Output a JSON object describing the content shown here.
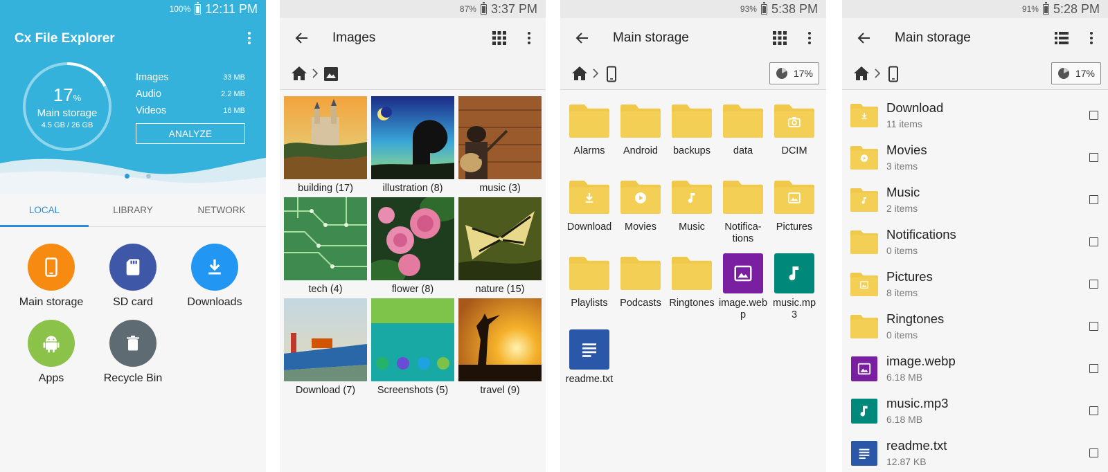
{
  "colors": {
    "accent": "#34b2dc",
    "tab_active": "#2d8ad8",
    "folder": "#f0c94c",
    "folder_glyph": "#ffffff",
    "image_tile": "#7b1fa2",
    "audio_tile": "#00897b",
    "text_tile": "#2b57a8"
  },
  "panel1": {
    "status": {
      "battery": "100%",
      "time": "12:11 PM"
    },
    "app_title": "Cx File Explorer",
    "storage": {
      "percent": "17",
      "percent_unit": "%",
      "label": "Main storage",
      "usage": "4.5 GB / 26 GB",
      "used_fraction": 0.17
    },
    "stats": [
      {
        "name": "Images",
        "value": "33 MB"
      },
      {
        "name": "Audio",
        "value": "2.2 MB"
      },
      {
        "name": "Videos",
        "value": "16 MB"
      }
    ],
    "analyze_label": "ANALYZE",
    "tabs": [
      "LOCAL",
      "LIBRARY",
      "NETWORK"
    ],
    "active_tab": 0,
    "shortcuts": [
      {
        "label": "Main storage",
        "icon": "phone-icon",
        "color": "#f78a10"
      },
      {
        "label": "SD card",
        "icon": "sd-card-icon",
        "color": "#3f57a7"
      },
      {
        "label": "Downloads",
        "icon": "download-icon",
        "color": "#2196f3"
      },
      {
        "label": "Apps",
        "icon": "android-icon",
        "color": "#8bc34a"
      },
      {
        "label": "Recycle Bin",
        "icon": "trash-icon",
        "color": "#5f6b73"
      }
    ]
  },
  "panel2": {
    "status": {
      "battery": "87%",
      "time": "3:37 PM"
    },
    "title": "Images",
    "albums": [
      {
        "caption": "building (17)"
      },
      {
        "caption": "illustration (8)"
      },
      {
        "caption": "music (3)"
      },
      {
        "caption": "tech (4)"
      },
      {
        "caption": "flower (8)"
      },
      {
        "caption": "nature (15)"
      },
      {
        "caption": "Download (7)"
      },
      {
        "caption": "Screenshots (5)"
      },
      {
        "caption": "travel (9)"
      }
    ]
  },
  "panel3": {
    "status": {
      "battery": "93%",
      "time": "5:38 PM"
    },
    "title": "Main storage",
    "usage_chip": "17%",
    "items": [
      {
        "label": "Alarms",
        "kind": "folder",
        "glyph": ""
      },
      {
        "label": "Android",
        "kind": "folder",
        "glyph": ""
      },
      {
        "label": "backups",
        "kind": "folder",
        "glyph": ""
      },
      {
        "label": "data",
        "kind": "folder",
        "glyph": ""
      },
      {
        "label": "DCIM",
        "kind": "folder",
        "glyph": "camera-icon"
      },
      {
        "label": "Download",
        "kind": "folder",
        "glyph": "download-icon"
      },
      {
        "label": "Movies",
        "kind": "folder",
        "glyph": "play-icon"
      },
      {
        "label": "Music",
        "kind": "folder",
        "glyph": "music-note-icon"
      },
      {
        "label": "Notifica-\ntions",
        "kind": "folder",
        "glyph": ""
      },
      {
        "label": "Pictures",
        "kind": "folder",
        "glyph": "image-icon"
      },
      {
        "label": "Playlists",
        "kind": "folder",
        "glyph": ""
      },
      {
        "label": "Podcasts",
        "kind": "folder",
        "glyph": ""
      },
      {
        "label": "Ringtones",
        "kind": "folder",
        "glyph": ""
      },
      {
        "label": "image.web\np",
        "kind": "image",
        "glyph": "image-icon"
      },
      {
        "label": "music.mp\n3",
        "kind": "audio",
        "glyph": "music-note-icon"
      },
      {
        "label": "readme.txt",
        "kind": "text",
        "glyph": "text-lines-icon"
      }
    ]
  },
  "panel4": {
    "status": {
      "battery": "91%",
      "time": "5:28 PM"
    },
    "title": "Main storage",
    "usage_chip": "17%",
    "rows": [
      {
        "name": "Download",
        "sub": "11 items",
        "kind": "folder",
        "glyph": "download-icon"
      },
      {
        "name": "Movies",
        "sub": "3 items",
        "kind": "folder",
        "glyph": "play-icon"
      },
      {
        "name": "Music",
        "sub": "2 items",
        "kind": "folder",
        "glyph": "music-note-icon"
      },
      {
        "name": "Notifications",
        "sub": "0 items",
        "kind": "folder",
        "glyph": ""
      },
      {
        "name": "Pictures",
        "sub": "8 items",
        "kind": "folder",
        "glyph": "image-icon"
      },
      {
        "name": "Ringtones",
        "sub": "0 items",
        "kind": "folder",
        "glyph": ""
      },
      {
        "name": "image.webp",
        "sub": "6.18 MB",
        "kind": "image",
        "glyph": "image-icon"
      },
      {
        "name": "music.mp3",
        "sub": "6.18 MB",
        "kind": "audio",
        "glyph": "music-note-icon"
      },
      {
        "name": "readme.txt",
        "sub": "12.87 KB",
        "kind": "text",
        "glyph": "text-lines-icon"
      }
    ]
  }
}
